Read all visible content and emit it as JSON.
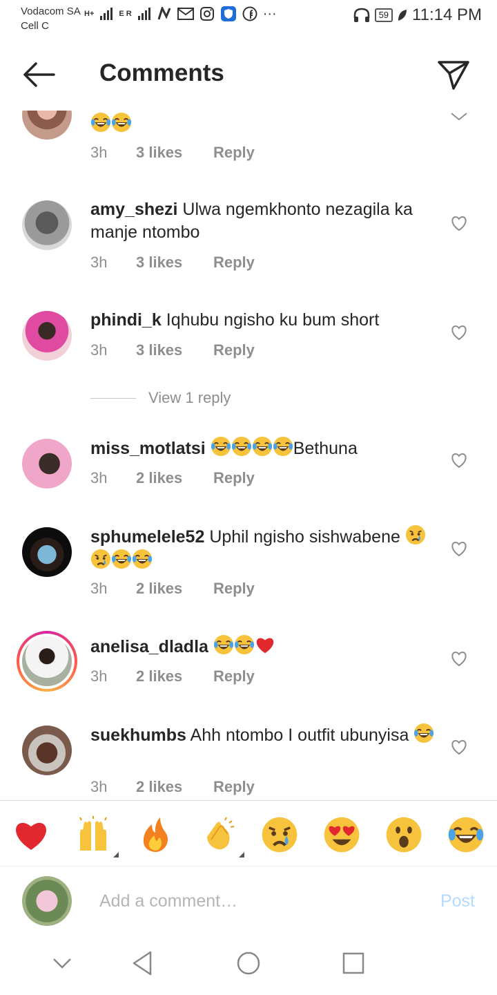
{
  "status_bar": {
    "carrier_1": "Vodacom SA",
    "carrier_2": "Cell C",
    "net_1": "H+",
    "net_2": "E R",
    "more": "···",
    "battery": "59",
    "time": "11:14 PM"
  },
  "header": {
    "title": "Comments"
  },
  "comments": [
    {
      "username": "",
      "text": "😂😂",
      "time": "3h",
      "likes": "3 likes",
      "reply": "Reply"
    },
    {
      "username": "amy_shezi",
      "text": "Ulwa ngemkhonto nezagila ka manje ntombo",
      "time": "3h",
      "likes": "3 likes",
      "reply": "Reply"
    },
    {
      "username": "phindi_k",
      "text": "Iqhubu ngisho ku bum short",
      "time": "3h",
      "likes": "3 likes",
      "reply": "Reply"
    },
    {
      "username": "miss_motlatsi",
      "text": "😂😂😂😂Bethuna",
      "time": "3h",
      "likes": "2 likes",
      "reply": "Reply"
    },
    {
      "username": "sphumelele52",
      "text": "Uphil ngisho sishwabene 😢😢😂😂",
      "time": "3h",
      "likes": "2 likes",
      "reply": "Reply"
    },
    {
      "username": "anelisa_dladla",
      "text": "😂😂❤️",
      "time": "3h",
      "likes": "2 likes",
      "reply": "Reply"
    },
    {
      "username": "suekhumbs",
      "text": "Ahh ntombo I outfit ubunyisa 😂",
      "time": "3h",
      "likes": "2 likes",
      "reply": "Reply"
    }
  ],
  "view_replies": "View 1 reply",
  "reactions": [
    "heart",
    "raised-hands",
    "fire",
    "clapping-hands",
    "crying-face",
    "heart-eyes",
    "surprised-face",
    "tears-of-joy"
  ],
  "input": {
    "placeholder": "Add a comment…",
    "post_label": "Post"
  },
  "colors": {
    "text": "#262626",
    "meta": "#8e8e8e",
    "post_disabled": "#b3dbff",
    "heart_red": "#e0282e",
    "emoji_yellow": "#f7c33c"
  }
}
